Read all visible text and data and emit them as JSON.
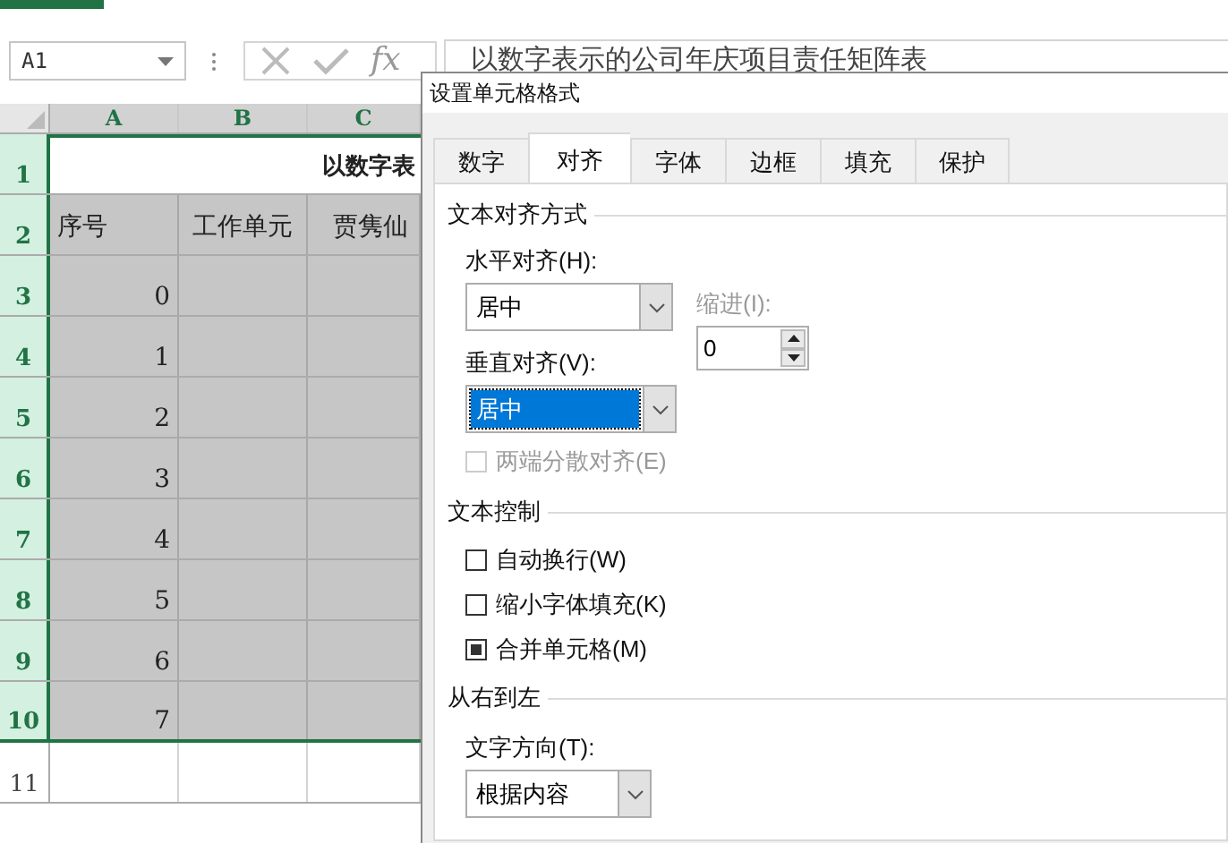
{
  "formula_bar": {
    "name_box": "A1",
    "fx": "fx",
    "formula": "以数字表示的公司年庆项目责任矩阵表"
  },
  "sheet": {
    "columns": [
      {
        "label": "A",
        "selected": true
      },
      {
        "label": "B",
        "selected": true
      },
      {
        "label": "C",
        "selected": true
      }
    ],
    "rows": [
      {
        "label": "1",
        "selected": true,
        "active": true,
        "cells": [
          "",
          "",
          "以数字表"
        ],
        "kind": "title"
      },
      {
        "label": "2",
        "selected": true,
        "active": false,
        "cells": [
          "序号",
          "工作单元",
          "贾隽仙"
        ],
        "kind": "header"
      },
      {
        "label": "3",
        "selected": true,
        "active": false,
        "cells": [
          "0",
          "",
          ""
        ],
        "kind": "data"
      },
      {
        "label": "4",
        "selected": true,
        "active": false,
        "cells": [
          "1",
          "",
          ""
        ],
        "kind": "data"
      },
      {
        "label": "5",
        "selected": true,
        "active": false,
        "cells": [
          "2",
          "",
          ""
        ],
        "kind": "data"
      },
      {
        "label": "6",
        "selected": true,
        "active": false,
        "cells": [
          "3",
          "",
          ""
        ],
        "kind": "data"
      },
      {
        "label": "7",
        "selected": true,
        "active": false,
        "cells": [
          "4",
          "",
          ""
        ],
        "kind": "data"
      },
      {
        "label": "8",
        "selected": true,
        "active": false,
        "cells": [
          "5",
          "",
          ""
        ],
        "kind": "data"
      },
      {
        "label": "9",
        "selected": true,
        "active": false,
        "cells": [
          "6",
          "",
          ""
        ],
        "kind": "data"
      },
      {
        "label": "10",
        "selected": true,
        "active": false,
        "cells": [
          "7",
          "",
          ""
        ],
        "kind": "data"
      },
      {
        "label": "11",
        "selected": false,
        "active": false,
        "cells": [
          "",
          "",
          ""
        ],
        "kind": "data"
      }
    ]
  },
  "dialog": {
    "title": "设置单元格格式",
    "tabs": [
      {
        "label": "数字",
        "selected": false
      },
      {
        "label": "对齐",
        "selected": true
      },
      {
        "label": "字体",
        "selected": false
      },
      {
        "label": "边框",
        "selected": false
      },
      {
        "label": "填充",
        "selected": false
      },
      {
        "label": "保护",
        "selected": false
      }
    ],
    "alignment": {
      "heading": "文本对齐方式",
      "horizontal": {
        "label": "水平对齐(H):",
        "value": "居中",
        "focused": false
      },
      "vertical": {
        "label": "垂直对齐(V):",
        "value": "居中",
        "focused": true
      },
      "indent": {
        "label": "缩进(I):",
        "value": "0",
        "disabled": true
      },
      "distributed": {
        "label": "两端分散对齐(E)",
        "checked": false,
        "disabled": true
      }
    },
    "text_control": {
      "heading": "文本控制",
      "options": [
        {
          "label": "自动换行(W)",
          "checked": false,
          "disabled": false
        },
        {
          "label": "缩小字体填充(K)",
          "checked": false,
          "disabled": false
        },
        {
          "label": "合并单元格(M)",
          "checked": true,
          "disabled": false
        }
      ]
    },
    "right_to_left": {
      "heading": "从右到左",
      "direction": {
        "label": "文字方向(T):",
        "value": "根据内容",
        "focused": false
      }
    }
  }
}
